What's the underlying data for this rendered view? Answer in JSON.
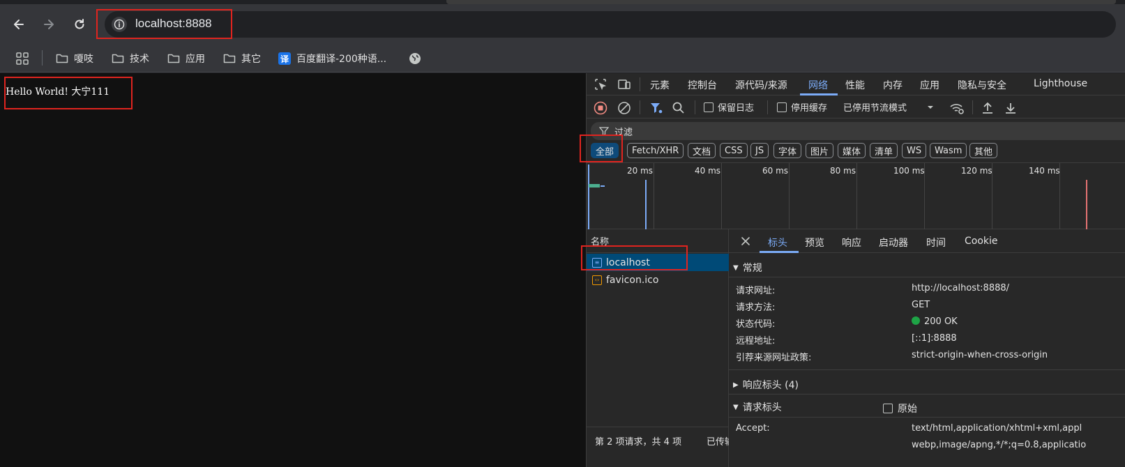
{
  "browser": {
    "url": "localhost:8888",
    "nav": {
      "back": "back-icon",
      "forward": "forward-icon",
      "reload": "reload-icon"
    }
  },
  "bookmarks": {
    "items": [
      {
        "label": "嗄吱",
        "icon": "folder-icon"
      },
      {
        "label": "技术",
        "icon": "folder-icon"
      },
      {
        "label": "应用",
        "icon": "folder-icon"
      },
      {
        "label": "其它",
        "icon": "folder-icon"
      },
      {
        "label": "百度翻译-200种语...",
        "icon": "translate-icon",
        "badge": "译"
      }
    ]
  },
  "page": {
    "content": "Hello World! 大宁111"
  },
  "devtools": {
    "tabs": [
      "元素",
      "控制台",
      "源代码/来源",
      "网络",
      "性能",
      "内存",
      "应用",
      "隐私与安全",
      "Lighthouse"
    ],
    "active_tab": "网络",
    "controls": {
      "preserve_log": "保留日志",
      "disable_cache": "停用缓存",
      "throttle": "已停用节流模式"
    },
    "filter_placeholder": "过滤",
    "chips": [
      "全部",
      "Fetch/XHR",
      "文档",
      "CSS",
      "JS",
      "字体",
      "图片",
      "媒体",
      "清单",
      "WS",
      "Wasm",
      "其他"
    ],
    "timeline_ticks": [
      "20 ms",
      "40 ms",
      "60 ms",
      "80 ms",
      "100 ms",
      "120 ms",
      "140 ms"
    ],
    "requests": {
      "header": "名称",
      "rows": [
        {
          "name": "localhost",
          "selected": true
        },
        {
          "name": "favicon.ico",
          "selected": false
        }
      ],
      "status": "第 2 项请求，共 4 项",
      "status2": "已传输"
    },
    "detail": {
      "tabs": [
        "标头",
        "预览",
        "响应",
        "启动器",
        "时间",
        "Cookie"
      ],
      "active_tab": "标头",
      "general": {
        "title": "常规",
        "rows": [
          {
            "key": "请求网址:",
            "value": "http://localhost:8888/"
          },
          {
            "key": "请求方法:",
            "value": "GET"
          },
          {
            "key": "状态代码:",
            "value": "200 OK"
          },
          {
            "key": "远程地址:",
            "value": "[::1]:8888"
          },
          {
            "key": "引荐来源网址政策:",
            "value": "strict-origin-when-cross-origin"
          }
        ]
      },
      "response_headers": "响应标头 (4)",
      "request_headers": "请求标头",
      "raw": "原始",
      "accept_key": "Accept:",
      "accept_value": "text/html,application/xhtml+xml,appl",
      "accept_value2": "webp,image/apng,*/*;q=0.8,applicatio"
    }
  },
  "colors": {
    "accent": "#7cacf8",
    "highlight": "#e0241f",
    "selected_row": "#004a77",
    "status_ok": "#1ea446"
  }
}
